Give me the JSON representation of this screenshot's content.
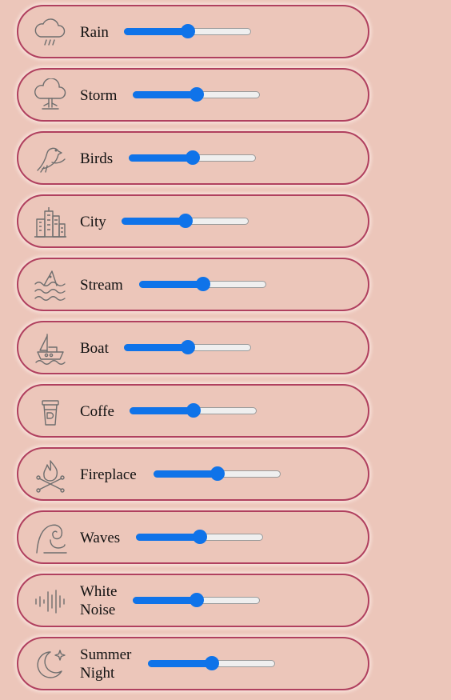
{
  "sounds": [
    {
      "id": "rain",
      "label": "Rain",
      "icon": "rain-cloud-icon",
      "volume": 0.5
    },
    {
      "id": "storm",
      "label": "Storm",
      "icon": "storm-cloud-icon",
      "volume": 0.5
    },
    {
      "id": "birds",
      "label": "Birds",
      "icon": "bird-icon",
      "volume": 0.5
    },
    {
      "id": "city",
      "label": "City",
      "icon": "city-buildings-icon",
      "volume": 0.5
    },
    {
      "id": "stream",
      "label": "Stream",
      "icon": "stream-fish-icon",
      "volume": 0.5
    },
    {
      "id": "boat",
      "label": "Boat",
      "icon": "boat-icon",
      "volume": 0.5
    },
    {
      "id": "coffe",
      "label": "Coffe",
      "icon": "coffee-cup-icon",
      "volume": 0.5
    },
    {
      "id": "fireplace",
      "label": "Fireplace",
      "icon": "campfire-icon",
      "volume": 0.5
    },
    {
      "id": "waves",
      "label": "Waves",
      "icon": "wave-icon",
      "volume": 0.5
    },
    {
      "id": "white-noise",
      "label": "White Noise",
      "label_lines": [
        "White",
        "Noise"
      ],
      "icon": "sound-wave-icon",
      "volume": 0.5
    },
    {
      "id": "summer-night",
      "label": "Summer Night",
      "label_lines": [
        "Summer",
        "Night"
      ],
      "icon": "moon-star-icon",
      "volume": 0.5
    }
  ],
  "colors": {
    "background": "#ecc6ba",
    "card_border": "#b0405f",
    "slider_fill": "#0f73e9",
    "slider_track": "#efefef",
    "icon_stroke": "#6e6e6e"
  }
}
